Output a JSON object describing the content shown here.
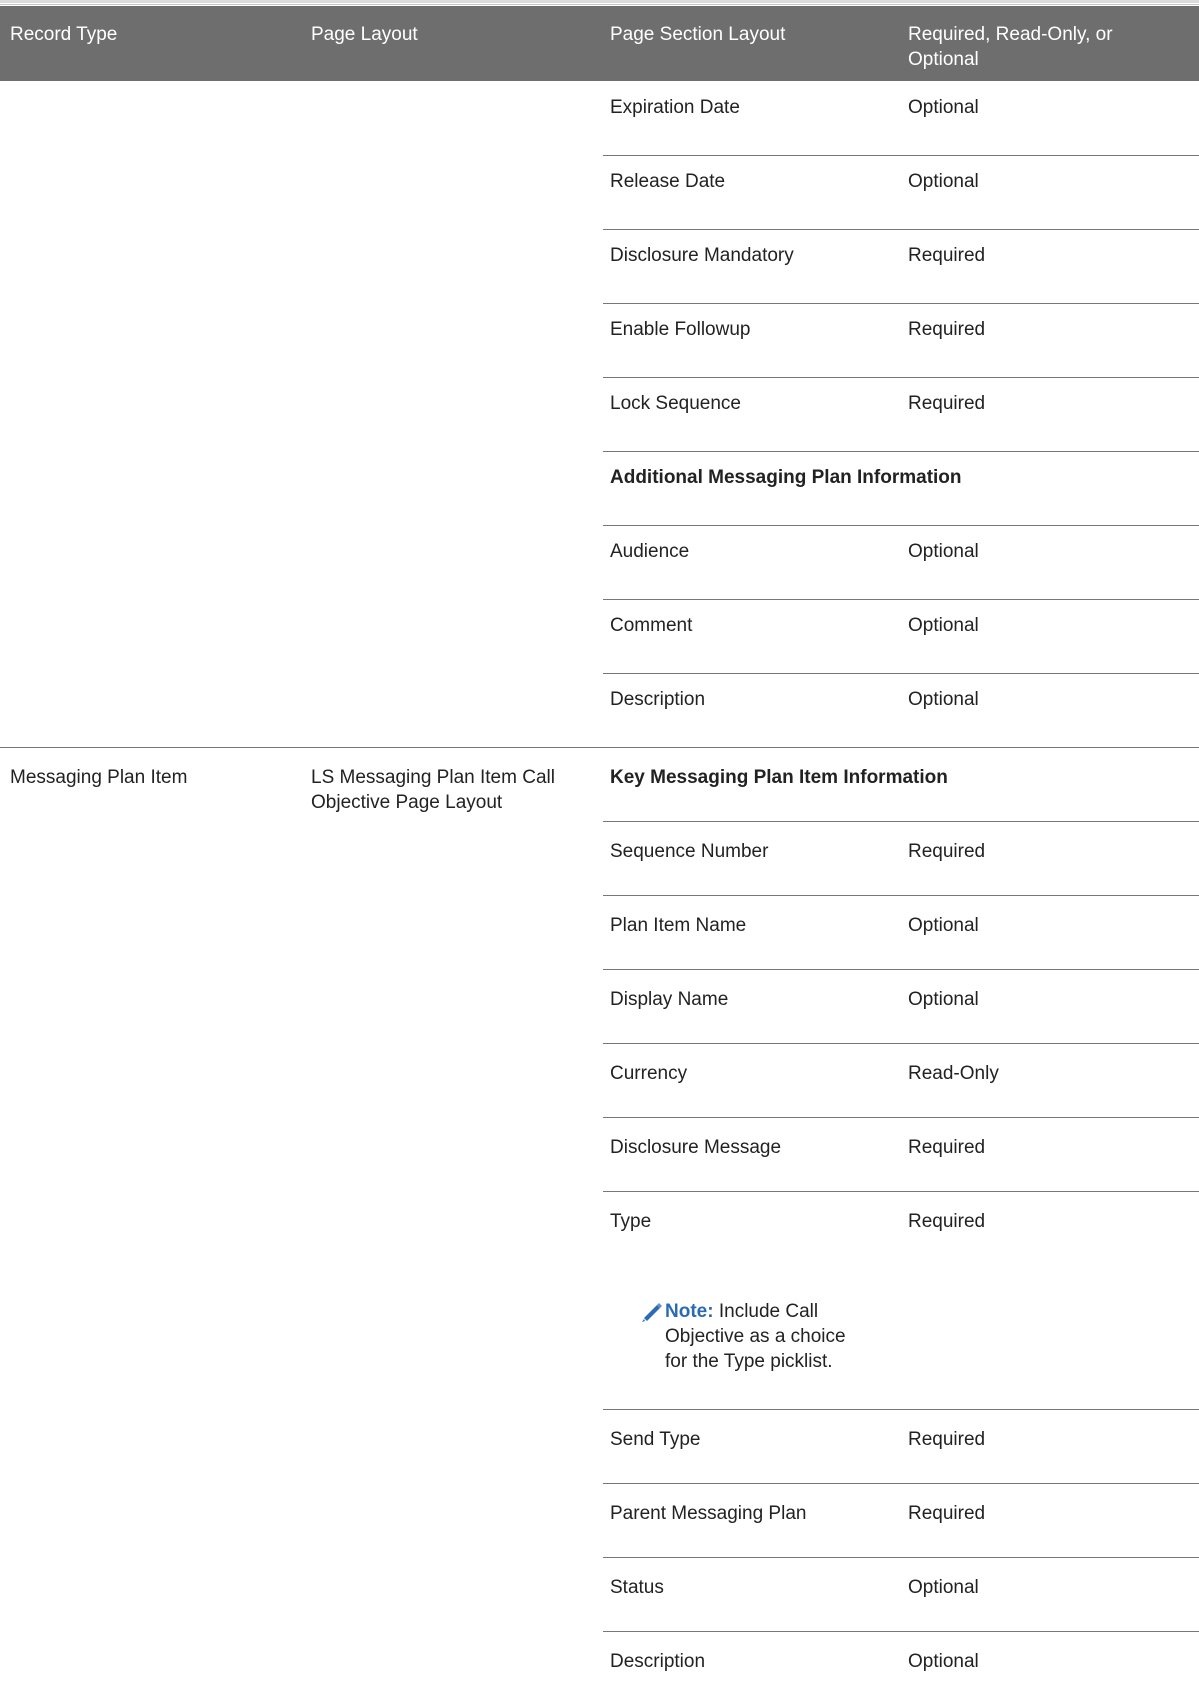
{
  "table": {
    "headers": {
      "record_type": "Record Type",
      "page_layout": "Page Layout",
      "page_section_layout": "Page Section Layout",
      "required": "Required, Read-Only, or Optional"
    },
    "record_type": "Messaging Plan Item",
    "page_layout": "LS Messaging Plan Item Call Objective Page Layout",
    "rows": [
      {
        "field": "Expiration Date",
        "value": "Optional"
      },
      {
        "field": "Release Date",
        "value": "Optional"
      },
      {
        "field": "Disclosure Mandatory",
        "value": "Required"
      },
      {
        "field": "Enable Followup",
        "value": "Required"
      },
      {
        "field": "Lock Sequence",
        "value": "Required"
      },
      {
        "field": "Additional Messaging Plan Information",
        "value": ""
      },
      {
        "field": "Audience",
        "value": "Optional"
      },
      {
        "field": "Comment",
        "value": "Optional"
      },
      {
        "field": "Description",
        "value": "Optional"
      },
      {
        "field": "Key Messaging Plan Item Information",
        "value": ""
      },
      {
        "field": "Sequence Number",
        "value": "Required"
      },
      {
        "field": "Plan Item Name",
        "value": "Optional"
      },
      {
        "field": "Display Name",
        "value": "Optional"
      },
      {
        "field": "Currency",
        "value": "Read-Only"
      },
      {
        "field": "Disclosure Message",
        "value": "Required"
      },
      {
        "field": "Type",
        "value": "Required"
      },
      {
        "field": "Send Type",
        "value": "Required"
      },
      {
        "field": "Parent Messaging Plan",
        "value": "Required"
      },
      {
        "field": "Status",
        "value": "Optional"
      },
      {
        "field": "Description",
        "value": "Optional"
      }
    ],
    "note": {
      "label": "Note:",
      "text": "Include Call Objective as a choice for the Type picklist.",
      "icon": "pencil-icon",
      "label_color": "#2b6cb0"
    }
  },
  "colors": {
    "header_bg": "#6e6e6e",
    "header_text": "#ffffff",
    "rule": "#777777"
  }
}
